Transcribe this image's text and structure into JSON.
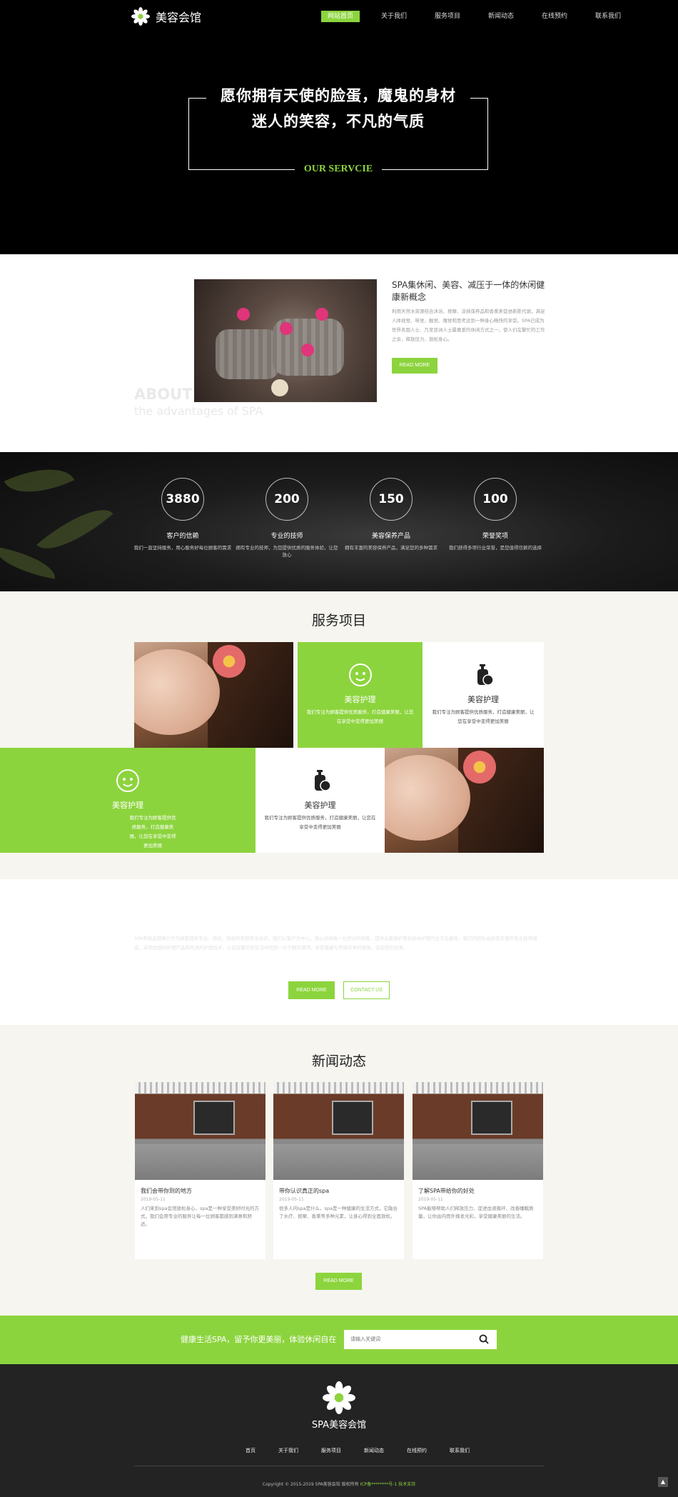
{
  "header": {
    "logo_text": "美容会馆",
    "nav": [
      "网站首页",
      "关于我们",
      "服务项目",
      "新闻动态",
      "在线预约",
      "联系我们"
    ]
  },
  "hero": {
    "line1": "愿你拥有天使的脸蛋，魔鬼的身材",
    "line2": "迷人的笑容，不凡的气质",
    "subtitle": "OUR SERVCIE"
  },
  "about": {
    "title": "SPA集休闲、美容、减压于一体的休闲健康新概念",
    "text": "利用天然水资源结合沐浴、按摩、涂抹保养品和香熏来促进新陈代谢，满足人体视觉、味觉、触觉、嗅觉和思考达到一种身心畅快的享受。SPA已成为世界各国人士、乃至亚洲人士最喜爱的休闲方式之一，使人们在繁忙的工作之余，释放压力、放松身心。",
    "button": "READ MORE",
    "label1": "ABOUT",
    "label2": "the advantages of SPA"
  },
  "stats": [
    {
      "number": "3880",
      "title": "客户的信赖",
      "desc": "我们一直坚持服务，用心服务好每位顾客的需求"
    },
    {
      "number": "200",
      "title": "专业的技师",
      "desc": "拥有专业的技师，为您提供优质的服务体验，让您放心"
    },
    {
      "number": "150",
      "title": "美容保养产品",
      "desc": "拥有丰富的美容保养产品，满足您的多种需求"
    },
    {
      "number": "100",
      "title": "荣誉奖项",
      "desc": "我们获得多项行业荣誉，是您值得信赖的选择"
    }
  ],
  "services": {
    "title": "服务项目",
    "items": [
      {
        "title": "美容护理",
        "desc": "我们专注为顾客提供优质服务，打造健康美丽，让您在享受中变得更加美丽"
      },
      {
        "title": "美容护理",
        "desc": "我们专注为顾客提供优质服务，打造健康美丽，让您在享受中变得更加美丽"
      },
      {
        "title": "美容护理",
        "desc": "我们专注为顾客提供优质服务，打造健康美丽，让您在享受中变得更加美丽"
      },
      {
        "title": "美容护理",
        "desc": "我们专注为顾客提供优质服务，打造健康美丽，让您在享受中变得更加美丽"
      }
    ]
  },
  "middle": {
    "text": "SPA美容会馆致力于为顾客提供专业、舒适、放松的美容养生体验，我们以客户为中心，用心对待每一位到访的顾客，提供从面部护理到身体护理的全方位服务。我们的团队由经验丰富的专业技师组成，采用优质的护理产品和先进的护理技术，让您在繁忙的生活中找到一片宁静的港湾，享受健康与美丽带来的愉悦。欢迎您的到来。",
    "read_more": "READ MORE",
    "contact": "CONTACT US"
  },
  "news": {
    "title": "新闻动态",
    "items": [
      {
        "title": "我们会带你到的地方",
        "date": "2019-05-11",
        "desc": "人们来到spa会馆放松身心，spa是一种享受美好时光的方式，我们会用专业的服务让每一位顾客都感到满意和舒适。"
      },
      {
        "title": "带你认识真正的spa",
        "date": "2019-05-11",
        "desc": "很多人问spa是什么，spa是一种健康的生活方式，它融合了水疗、按摩、香熏等多种元素，让身心得到全面放松。"
      },
      {
        "title": "了解SPA带给你的好处",
        "date": "2019-05-11",
        "desc": "SPA能够帮助人们释放压力、促进血液循环、改善睡眠质量，让你由内而外焕发光彩，享受健康美丽的生活。"
      }
    ],
    "button": "READ MORE"
  },
  "subscribe": {
    "text": "健康生活SPA，留予你更美丽，体验休闲自在",
    "placeholder": "请输入关键词"
  },
  "footer": {
    "name": "SPA美容会馆",
    "nav": [
      "首页",
      "关于我们",
      "服务项目",
      "新闻动态",
      "在线预约",
      "联系我们"
    ],
    "copyright": "Copyright © 2015-2019 SPA美容会馆 版权所有",
    "icp": "ICP备********号-1 技术支持"
  },
  "colors": {
    "accent": "#8cd43d",
    "hero_bg": "#000000",
    "footer_bg": "#232323",
    "section_bg": "#f6f5f0"
  },
  "icons": [
    "flower-logo-icon",
    "face-mask-icon",
    "lotion-bottle-icon",
    "search-icon",
    "back-to-top-icon"
  ]
}
